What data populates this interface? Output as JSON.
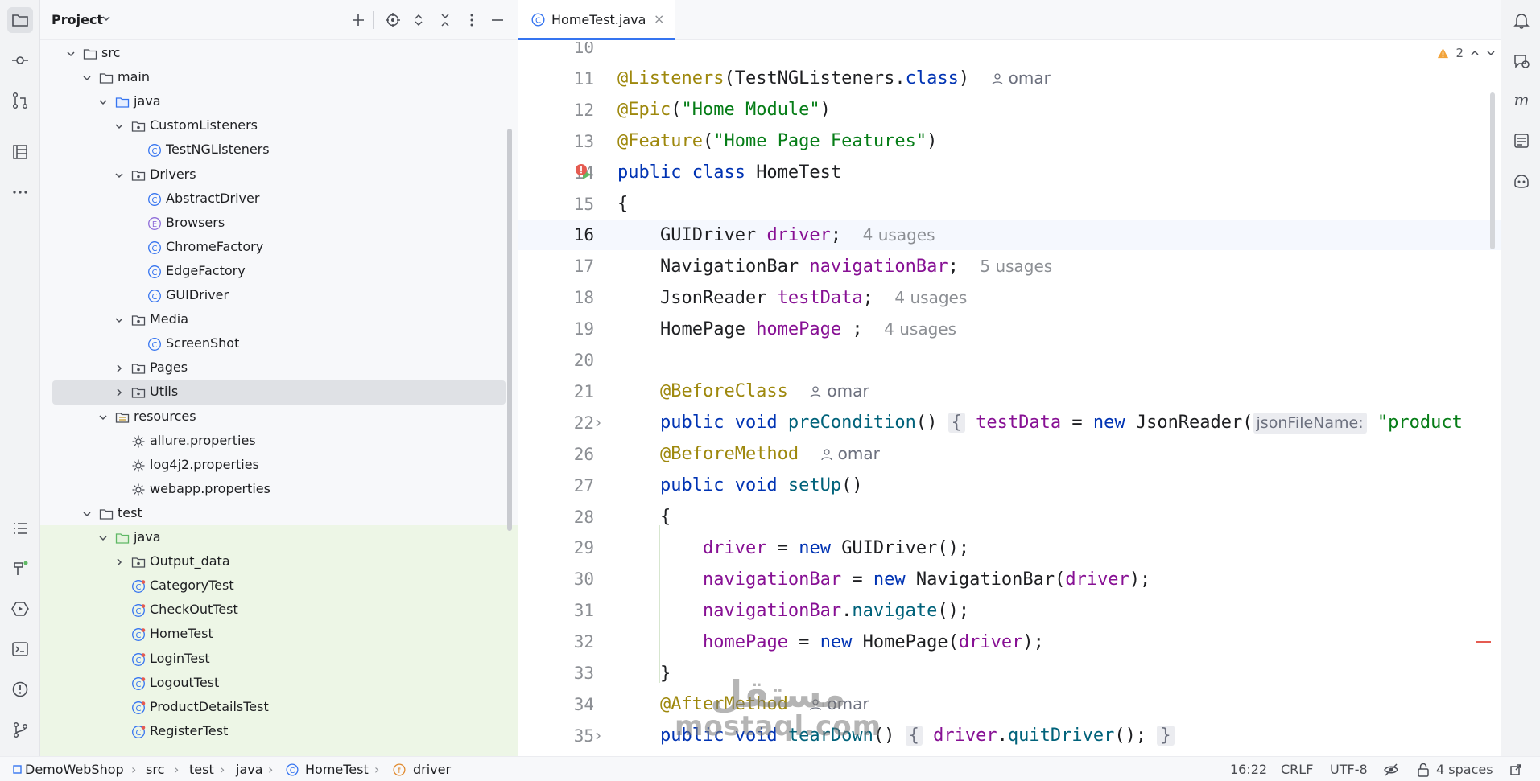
{
  "left_strip": {
    "icons": [
      "folder-icon",
      "commit-icon",
      "pull-requests-icon",
      "structure-icon",
      "more-icon",
      "todo-icon",
      "build-icon",
      "services-icon",
      "terminal-icon",
      "problems-icon",
      "git-icon"
    ]
  },
  "project_panel": {
    "title": "Project",
    "tree": [
      {
        "label": "src",
        "kind": "folder",
        "depth": 0,
        "expanded": true
      },
      {
        "label": "main",
        "kind": "folder",
        "depth": 1,
        "expanded": true
      },
      {
        "label": "java",
        "kind": "source-folder",
        "depth": 2,
        "expanded": true
      },
      {
        "label": "CustomListeners",
        "kind": "package",
        "depth": 3,
        "expanded": true
      },
      {
        "label": "TestNGListeners",
        "kind": "class",
        "depth": 4
      },
      {
        "label": "Drivers",
        "kind": "package",
        "depth": 3,
        "expanded": true
      },
      {
        "label": "AbstractDriver",
        "kind": "class",
        "depth": 4
      },
      {
        "label": "Browsers",
        "kind": "enum",
        "depth": 4
      },
      {
        "label": "ChromeFactory",
        "kind": "class",
        "depth": 4
      },
      {
        "label": "EdgeFactory",
        "kind": "class",
        "depth": 4
      },
      {
        "label": "GUIDriver",
        "kind": "class",
        "depth": 4
      },
      {
        "label": "Media",
        "kind": "package",
        "depth": 3,
        "expanded": true
      },
      {
        "label": "ScreenShot",
        "kind": "class",
        "depth": 4
      },
      {
        "label": "Pages",
        "kind": "package",
        "depth": 3,
        "expanded": false
      },
      {
        "label": "Utils",
        "kind": "package",
        "depth": 3,
        "expanded": false,
        "selected": true
      },
      {
        "label": "resources",
        "kind": "resources-folder",
        "depth": 2,
        "expanded": true
      },
      {
        "label": "allure.properties",
        "kind": "properties",
        "depth": 3
      },
      {
        "label": "log4j2.properties",
        "kind": "properties",
        "depth": 3
      },
      {
        "label": "webapp.properties",
        "kind": "properties",
        "depth": 3
      },
      {
        "label": "test",
        "kind": "folder",
        "depth": 1,
        "expanded": true
      },
      {
        "label": "java",
        "kind": "test-folder",
        "depth": 2,
        "expanded": true
      },
      {
        "label": "Output_data",
        "kind": "package",
        "depth": 3,
        "expanded": false
      },
      {
        "label": "CategoryTest",
        "kind": "test-class",
        "depth": 3
      },
      {
        "label": "CheckOutTest",
        "kind": "test-class",
        "depth": 3
      },
      {
        "label": "HomeTest",
        "kind": "test-class",
        "depth": 3
      },
      {
        "label": "LoginTest",
        "kind": "test-class",
        "depth": 3
      },
      {
        "label": "LogoutTest",
        "kind": "test-class",
        "depth": 3
      },
      {
        "label": "ProductDetailsTest",
        "kind": "test-class",
        "depth": 3
      },
      {
        "label": "RegisterTest",
        "kind": "test-class",
        "depth": 3
      }
    ]
  },
  "editor": {
    "tab": {
      "label": "HomeTest.java",
      "close": "×"
    },
    "warnings": {
      "count": "2"
    },
    "current_line": "16",
    "lines": [
      {
        "n": "10",
        "segs": []
      },
      {
        "n": "11",
        "segs": [
          [
            "ann",
            "@Listeners"
          ],
          [
            "plain",
            "("
          ],
          [
            "plain",
            "TestNGListeners."
          ],
          [
            "kw",
            "class"
          ],
          [
            "plain",
            ")  "
          ],
          [
            "author",
            "omar"
          ]
        ]
      },
      {
        "n": "12",
        "segs": [
          [
            "ann",
            "@Epic"
          ],
          [
            "plain",
            "("
          ],
          [
            "str",
            "\"Home Module\""
          ],
          [
            "plain",
            ")"
          ]
        ]
      },
      {
        "n": "13",
        "segs": [
          [
            "ann",
            "@Feature"
          ],
          [
            "plain",
            "("
          ],
          [
            "str",
            "\"Home Page Features\""
          ],
          [
            "plain",
            ")"
          ]
        ]
      },
      {
        "n": "14",
        "segs": [
          [
            "kw",
            "public class "
          ],
          [
            "plain",
            "HomeTest"
          ]
        ]
      },
      {
        "n": "15",
        "segs": [
          [
            "plain",
            "{"
          ]
        ]
      },
      {
        "n": "16",
        "segs": [
          [
            "plain",
            "    GUIDriver "
          ],
          [
            "fld",
            "driver"
          ],
          [
            "plain",
            ";  "
          ],
          [
            "hint",
            "4 usages"
          ]
        ]
      },
      {
        "n": "17",
        "segs": [
          [
            "plain",
            "    NavigationBar "
          ],
          [
            "fld",
            "navigationBar"
          ],
          [
            "plain",
            ";  "
          ],
          [
            "hint",
            "5 usages"
          ]
        ]
      },
      {
        "n": "18",
        "segs": [
          [
            "plain",
            "    JsonReader "
          ],
          [
            "fld",
            "testData"
          ],
          [
            "plain",
            ";  "
          ],
          [
            "hint",
            "4 usages"
          ]
        ]
      },
      {
        "n": "19",
        "segs": [
          [
            "plain",
            "    HomePage "
          ],
          [
            "fld",
            "homePage"
          ],
          [
            "plain",
            " ;  "
          ],
          [
            "hint",
            "4 usages"
          ]
        ]
      },
      {
        "n": "20",
        "segs": []
      },
      {
        "n": "21",
        "segs": [
          [
            "ann",
            "    @BeforeClass"
          ],
          [
            "plain",
            "  "
          ],
          [
            "author",
            "omar"
          ]
        ]
      },
      {
        "n": "22",
        "segs": [
          [
            "kw",
            "    public void "
          ],
          [
            "mth",
            "preCondition"
          ],
          [
            "plain",
            "() "
          ],
          [
            "fold",
            "{"
          ],
          [
            "plain",
            " "
          ],
          [
            "fld",
            "testData"
          ],
          [
            "plain",
            " = "
          ],
          [
            "kw",
            "new "
          ],
          [
            "plain",
            "JsonReader("
          ],
          [
            "inlay",
            "jsonFileName:"
          ],
          [
            "plain",
            " "
          ],
          [
            "str",
            "\"product"
          ]
        ]
      },
      {
        "n": "26",
        "segs": [
          [
            "ann",
            "    @BeforeMethod"
          ],
          [
            "plain",
            "  "
          ],
          [
            "author",
            "omar"
          ]
        ]
      },
      {
        "n": "27",
        "segs": [
          [
            "kw",
            "    public void "
          ],
          [
            "mth",
            "setUp"
          ],
          [
            "plain",
            "()"
          ]
        ]
      },
      {
        "n": "28",
        "segs": [
          [
            "plain",
            "    {"
          ]
        ]
      },
      {
        "n": "29",
        "segs": [
          [
            "plain",
            "        "
          ],
          [
            "fld",
            "driver"
          ],
          [
            "plain",
            " = "
          ],
          [
            "kw",
            "new "
          ],
          [
            "plain",
            "GUIDriver();"
          ]
        ]
      },
      {
        "n": "30",
        "segs": [
          [
            "plain",
            "        "
          ],
          [
            "fld",
            "navigationBar"
          ],
          [
            "plain",
            " = "
          ],
          [
            "kw",
            "new "
          ],
          [
            "plain",
            "NavigationBar("
          ],
          [
            "fld",
            "driver"
          ],
          [
            "plain",
            ");"
          ]
        ]
      },
      {
        "n": "31",
        "segs": [
          [
            "plain",
            "        "
          ],
          [
            "fld",
            "navigationBar"
          ],
          [
            "plain",
            "."
          ],
          [
            "mth",
            "navigate"
          ],
          [
            "plain",
            "();"
          ]
        ]
      },
      {
        "n": "32",
        "segs": [
          [
            "plain",
            "        "
          ],
          [
            "fld",
            "homePage"
          ],
          [
            "plain",
            " = "
          ],
          [
            "kw",
            "new "
          ],
          [
            "plain",
            "HomePage("
          ],
          [
            "fld",
            "driver"
          ],
          [
            "plain",
            ");"
          ]
        ]
      },
      {
        "n": "33",
        "segs": [
          [
            "plain",
            "    }"
          ]
        ]
      },
      {
        "n": "34",
        "segs": [
          [
            "ann",
            "    @AfterMethod"
          ],
          [
            "plain",
            "  "
          ],
          [
            "author",
            "omar"
          ]
        ]
      },
      {
        "n": "35",
        "segs": [
          [
            "kw",
            "    public void "
          ],
          [
            "mth",
            "tearDown"
          ],
          [
            "plain",
            "() "
          ],
          [
            "fold",
            "{"
          ],
          [
            "plain",
            " "
          ],
          [
            "fld",
            "driver"
          ],
          [
            "plain",
            "."
          ],
          [
            "mth",
            "quitDriver"
          ],
          [
            "plain",
            "(); "
          ],
          [
            "fold",
            "}"
          ]
        ]
      }
    ]
  },
  "right_strip": {
    "icons": [
      "notifications-icon",
      "ai-chat-icon",
      "maven-icon",
      "database-icon",
      "copilot-icon"
    ]
  },
  "status_bar": {
    "breadcrumbs": [
      "DemoWebShop",
      "src",
      "test",
      "java",
      "HomeTest",
      "driver"
    ],
    "position": "16:22",
    "line_separator": "CRLF",
    "encoding": "UTF-8",
    "indent": "4 spaces"
  },
  "watermark": {
    "arabic": "مستقل",
    "latin": "mostaql.com"
  },
  "colors": {
    "accent": "#3574f0",
    "annotation": "#9e880d",
    "string": "#067d17",
    "keyword": "#0033b3",
    "field": "#871094",
    "method": "#00627a",
    "test_bg": "#edf6e6"
  }
}
